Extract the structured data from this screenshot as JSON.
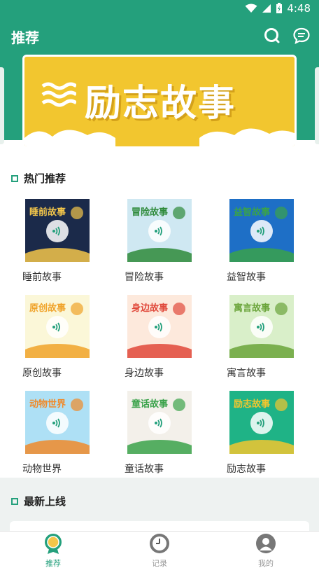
{
  "status": {
    "time": "4:48"
  },
  "appbar": {
    "title": "推荐",
    "search_icon": "search-icon",
    "message_icon": "message-icon"
  },
  "banner": {
    "text": "励志故事"
  },
  "hot": {
    "title": "热门推荐",
    "items": [
      {
        "label": "睡前故事",
        "bg": "#1b2a4a",
        "accent": "#f3c64a"
      },
      {
        "label": "冒险故事",
        "bg": "#cfe8f2",
        "accent": "#2e8a3a"
      },
      {
        "label": "益智故事",
        "bg": "#1e6fc6",
        "accent": "#3aa24a"
      },
      {
        "label": "原创故事",
        "bg": "#fbf7d8",
        "accent": "#f0a32a"
      },
      {
        "label": "身边故事",
        "bg": "#fde9dc",
        "accent": "#e0483a"
      },
      {
        "label": "寓言故事",
        "bg": "#d9efc9",
        "accent": "#6aa43a"
      },
      {
        "label": "动物世界",
        "bg": "#aee0f5",
        "accent": "#f08a2a"
      },
      {
        "label": "童话故事",
        "bg": "#f3f0ea",
        "accent": "#3aa24a"
      },
      {
        "label": "励志故事",
        "bg": "#1fb386",
        "accent": "#f2c62f"
      }
    ],
    "thumb_texts": [
      "睡前故事",
      "冒险故事",
      "益智故事",
      "原创故事",
      "身边故事",
      "寓言故事",
      "动物世界",
      "童话故事",
      "励志故事"
    ]
  },
  "latest": {
    "title": "最新上线"
  },
  "nav": {
    "items": [
      {
        "label": "推荐",
        "active": true
      },
      {
        "label": "记录",
        "active": false
      },
      {
        "label": "我的",
        "active": false
      }
    ]
  },
  "colors": {
    "primary": "#24a07c",
    "inactive": "#9a9a9a"
  }
}
